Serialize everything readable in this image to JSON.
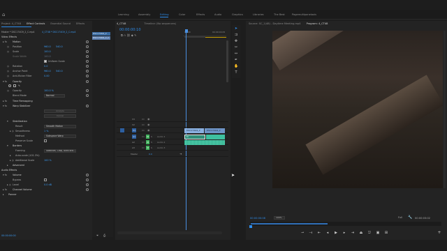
{
  "workspace_tabs": [
    {
      "label": "Learning",
      "active": false
    },
    {
      "label": "Assembly",
      "active": false
    },
    {
      "label": "Editing",
      "active": true
    },
    {
      "label": "Color",
      "active": false
    },
    {
      "label": "Effects",
      "active": false
    },
    {
      "label": "Audio",
      "active": false
    },
    {
      "label": "Graphics",
      "active": false
    },
    {
      "label": "Libraries",
      "active": false
    },
    {
      "label": "The Best",
      "active": false
    },
    {
      "label": "Pagemultipanelaxis",
      "active": false
    }
  ],
  "effect_panel": {
    "tabs": [
      "Project: 4_CT48",
      "Effect Controls",
      "Essential Sound",
      "Effects"
    ],
    "source_line": "Master * DSC174G9_2_C.mp4",
    "seq_line": "4_CT48 * DSC174G9_2_C.mp4",
    "clip_badge": "DSC174G9_2_C",
    "video_effects": "Video Effects",
    "motion": "Motion",
    "position": {
      "label": "Position",
      "x": "960.0",
      "y": "540.0"
    },
    "scale": {
      "label": "Scale",
      "value": "100.0"
    },
    "scale_width": {
      "label": "Scale Width",
      "value": "100.0"
    },
    "uniform_scale": "Uniform Scale",
    "rotation": {
      "label": "Rotation",
      "value": "0.0"
    },
    "anchor": {
      "label": "Anchor Point",
      "x": "960.0",
      "y": "540.0"
    },
    "anti_flicker": {
      "label": "Anti-flicker Filter",
      "value": "0.00"
    },
    "opacity_group": "Opacity",
    "opacity": {
      "label": "Opacity",
      "value": "100.0 %"
    },
    "blend_mode": {
      "label": "Blend Mode",
      "value": "Normal"
    },
    "time_remap": "Time Remapping",
    "warp": "Warp Stabilizer",
    "analyze_btn": "Analyze",
    "cancel_btn": "Cancel",
    "stabilization": "Stabilization",
    "result": {
      "label": "Result",
      "value": "Smooth Motion"
    },
    "smoothness": {
      "label": "Smoothness",
      "value": "1 %"
    },
    "method": {
      "label": "Method",
      "value": "Subspace Warp"
    },
    "preserve_scale": "Preserve Scale",
    "borders": "Borders",
    "framing": {
      "label": "Framing",
      "value": "Stabilize, Crop, Auto-sca..."
    },
    "auto_scale": {
      "label": "Auto-scale (101.3%)"
    },
    "additional_scale": {
      "label": "Additional Scale",
      "value": "100 %"
    },
    "advanced": "Advanced",
    "audio_effects": "Audio Effects",
    "volume": "Volume",
    "bypass": "Bypass",
    "level": {
      "label": "Level",
      "value": "0.0 dB"
    },
    "channel_volume": "Channel Volume",
    "panner": "Panner",
    "timecode": "00:00:00:00"
  },
  "mini_timeline": {
    "clip_label": "DSC174G9_2"
  },
  "timeline": {
    "tabs": [
      "4_CT48",
      "Timeline: (No sequences)"
    ],
    "timecode": "00:00:00:10",
    "ruler_start": "00:00",
    "ruler_end": "00:00:00:05",
    "tracks_video": [
      "V3",
      "V2",
      "V1"
    ],
    "tracks_audio": [
      {
        "name": "A1",
        "label": "Audio 1"
      },
      {
        "name": "A2",
        "label": "Audio 2"
      },
      {
        "name": "A3",
        "label": "Audio 3"
      }
    ],
    "master_label": "Master",
    "master_value": "0.0",
    "clip_v1_a": "DSC174G9_2",
    "clip_v1_b": "DSC174G9_2",
    "clip_a1": "M"
  },
  "source_tabs": [
    "Source: SC_1(48) - Daytime Meeting.mp4",
    "Program: 4_CT48"
  ],
  "program": {
    "timecode_left": "00:00:00:08",
    "zoom": "Fit",
    "quality": "Full",
    "timecode_right": "00:00:03:02",
    "fit_select": "100%"
  },
  "colors": {
    "accent": "#2d8ceb",
    "playhead": "#4a8fe0",
    "video_clip": "#8ab0e0",
    "audio_clip": "#3ec0a0",
    "track_on": "#3fb05b"
  }
}
